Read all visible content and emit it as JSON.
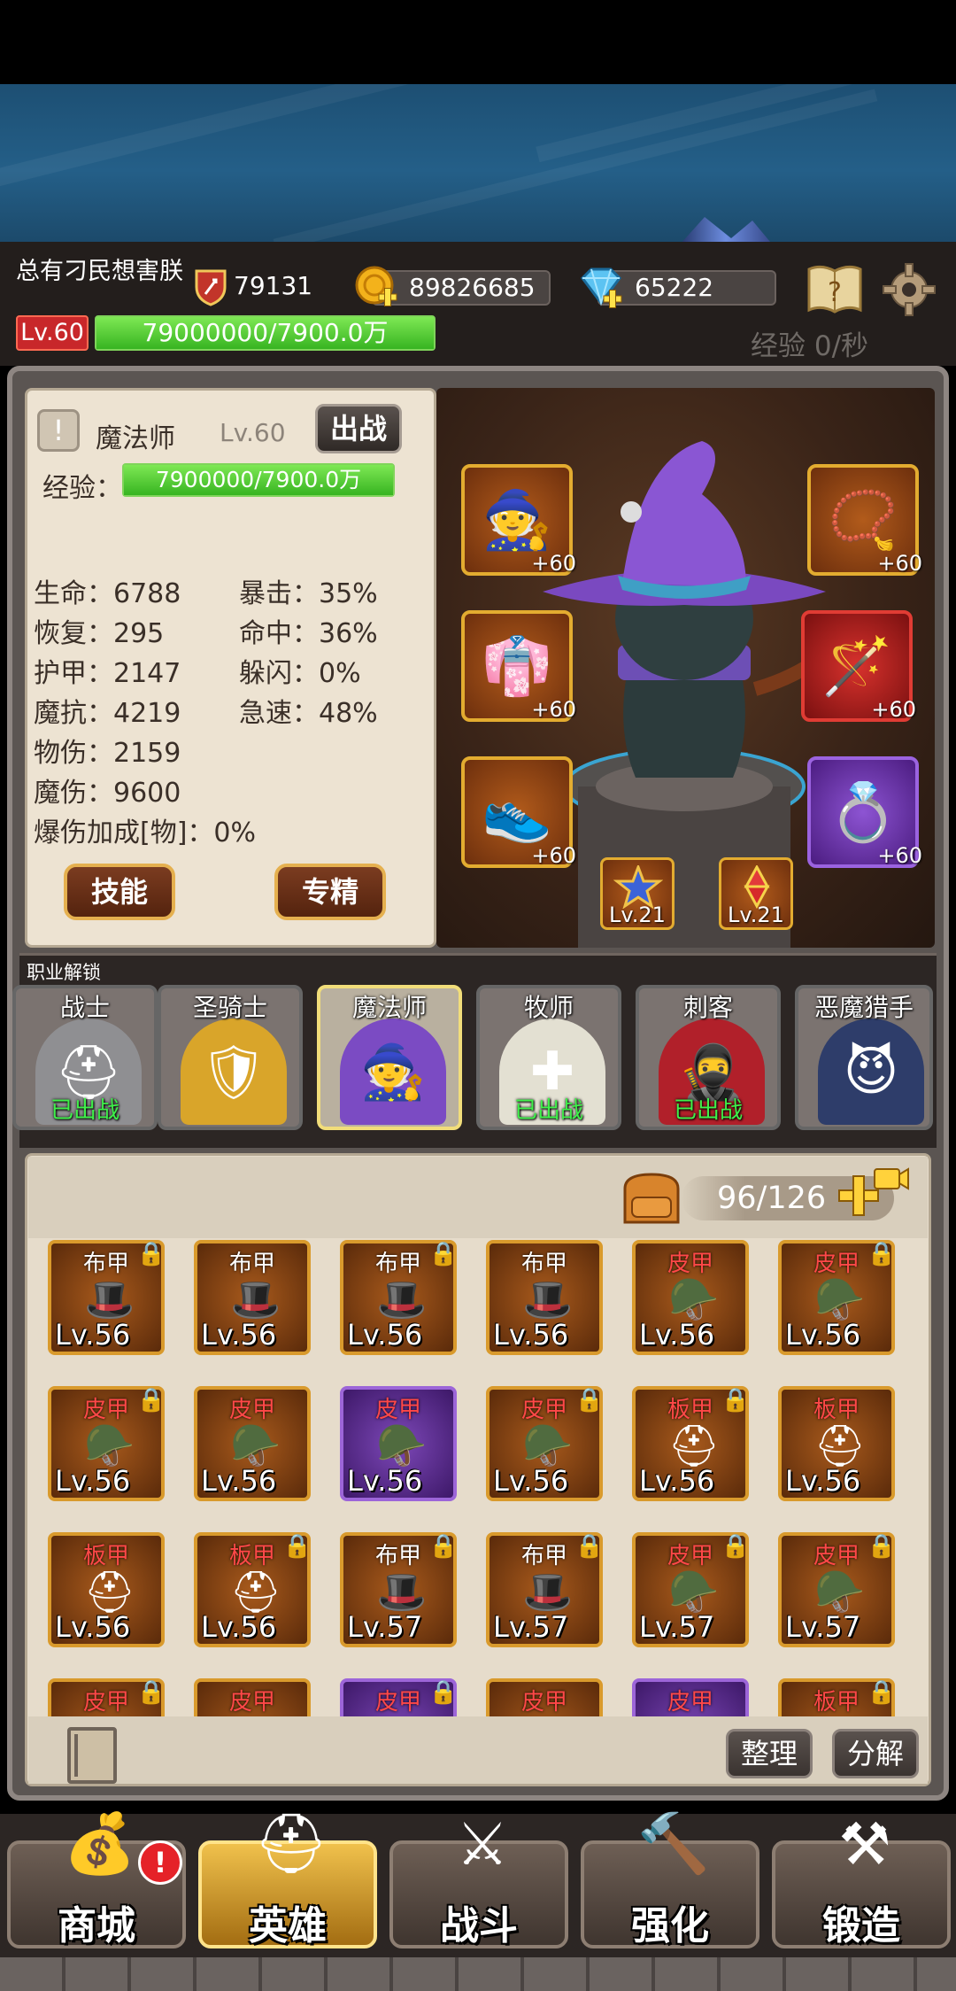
{
  "player": {
    "name": "总有刁民想害朕",
    "power": "79131",
    "gold": "89826685",
    "diamonds": "65222",
    "level_badge": "Lv.60",
    "exp_bar_text": "79000000/7900.0万",
    "exp_fraction": 1.0,
    "exp_rate": "经验 0/秒"
  },
  "hero": {
    "class_name": "魔法师",
    "level": "Lv.60",
    "deploy_label": "出战",
    "exp_label": "经验：",
    "exp_bar_text": "7900000/7900.0万",
    "exp_fraction": 1.0,
    "stats_left": [
      "生命：6788",
      "恢复：295",
      "护甲：2147",
      "魔抗：4219",
      "物伤：2159",
      "魔伤：9600",
      "爆伤加成[物]：0%"
    ],
    "stats_right": [
      "暴击：35%",
      "命中：36%",
      "躲闪：0%",
      "急速：48%"
    ],
    "skill_button": "技能",
    "mastery_button": "专精"
  },
  "equipment": {
    "helmet_plus": "+60",
    "armor_plus": "+60",
    "boots_plus": "+60",
    "necklace_plus": "+60",
    "weapon_plus": "+60",
    "ring_plus": "+60",
    "badge1_level": "Lv.21",
    "badge2_level": "Lv.21"
  },
  "unlock": {
    "title": "职业解锁",
    "heroes": [
      {
        "name": "战士",
        "status": "已出战"
      },
      {
        "name": "圣骑士",
        "status": ""
      },
      {
        "name": "魔法师",
        "status": ""
      },
      {
        "name": "牧师",
        "status": "已出战"
      },
      {
        "name": "刺客",
        "status": "已出战"
      },
      {
        "name": "恶魔猎手",
        "status": ""
      }
    ]
  },
  "inventory": {
    "capacity": "96/126",
    "rows": [
      [
        {
          "type": "布甲",
          "level": "Lv.56",
          "locked": true
        },
        {
          "type": "布甲",
          "level": "Lv.56",
          "locked": false
        },
        {
          "type": "布甲",
          "level": "Lv.56",
          "locked": true
        },
        {
          "type": "布甲",
          "level": "Lv.56",
          "locked": false
        },
        {
          "type": "皮甲",
          "level": "Lv.56",
          "locked": false
        },
        {
          "type": "皮甲",
          "level": "Lv.56",
          "locked": true
        }
      ],
      [
        {
          "type": "皮甲",
          "level": "Lv.56",
          "locked": true
        },
        {
          "type": "皮甲",
          "level": "Lv.56",
          "locked": false
        },
        {
          "type": "皮甲",
          "level": "Lv.56",
          "locked": false
        },
        {
          "type": "皮甲",
          "level": "Lv.56",
          "locked": true
        },
        {
          "type": "板甲",
          "level": "Lv.56",
          "locked": true
        },
        {
          "type": "板甲",
          "level": "Lv.56",
          "locked": false
        }
      ],
      [
        {
          "type": "板甲",
          "level": "Lv.56",
          "locked": false
        },
        {
          "type": "板甲",
          "level": "Lv.56",
          "locked": true
        },
        {
          "type": "布甲",
          "level": "Lv.57",
          "locked": true
        },
        {
          "type": "布甲",
          "level": "Lv.57",
          "locked": true
        },
        {
          "type": "皮甲",
          "level": "Lv.57",
          "locked": true
        },
        {
          "type": "皮甲",
          "level": "Lv.57",
          "locked": true
        }
      ],
      [
        {
          "type": "皮甲",
          "level": "",
          "locked": true
        },
        {
          "type": "皮甲",
          "level": "",
          "locked": false
        },
        {
          "type": "皮甲",
          "level": "",
          "locked": true
        },
        {
          "type": "皮甲",
          "level": "",
          "locked": false
        },
        {
          "type": "皮甲",
          "level": "",
          "locked": false
        },
        {
          "type": "板甲",
          "level": "",
          "locked": true
        }
      ]
    ],
    "sort_button": "整理",
    "dismantle_button": "分解"
  },
  "nav": {
    "shop": "商城",
    "heroes": "英雄",
    "battle": "战斗",
    "enhance": "强化",
    "forge": "锻造",
    "shop_alert": "!"
  },
  "colors": {
    "accent_gold": "#e5b04f",
    "exp_green": "#5cd43a",
    "deployed_green": "#3ff04a",
    "rarity_purple": "#9c65d8"
  }
}
